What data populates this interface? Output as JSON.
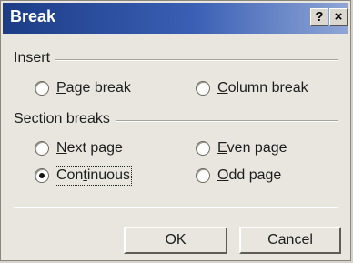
{
  "window": {
    "title": "Break",
    "help_glyph": "?",
    "close_glyph": "×"
  },
  "insert_group": {
    "label": "Insert",
    "options": [
      {
        "mnemonic": "P",
        "rest": "age break",
        "checked": false
      },
      {
        "mnemonic": "C",
        "rest": "olumn break",
        "checked": false
      }
    ]
  },
  "section_group": {
    "label": "Section breaks",
    "options": [
      {
        "mnemonic": "N",
        "rest": "ext page",
        "checked": false
      },
      {
        "mnemonic": "E",
        "rest": "ven page",
        "checked": false
      },
      {
        "pre": "Con",
        "mnemonic": "t",
        "rest": "inuous",
        "checked": true
      },
      {
        "mnemonic": "O",
        "rest": "dd page",
        "checked": false
      }
    ]
  },
  "buttons": {
    "ok": "OK",
    "cancel": "Cancel"
  }
}
